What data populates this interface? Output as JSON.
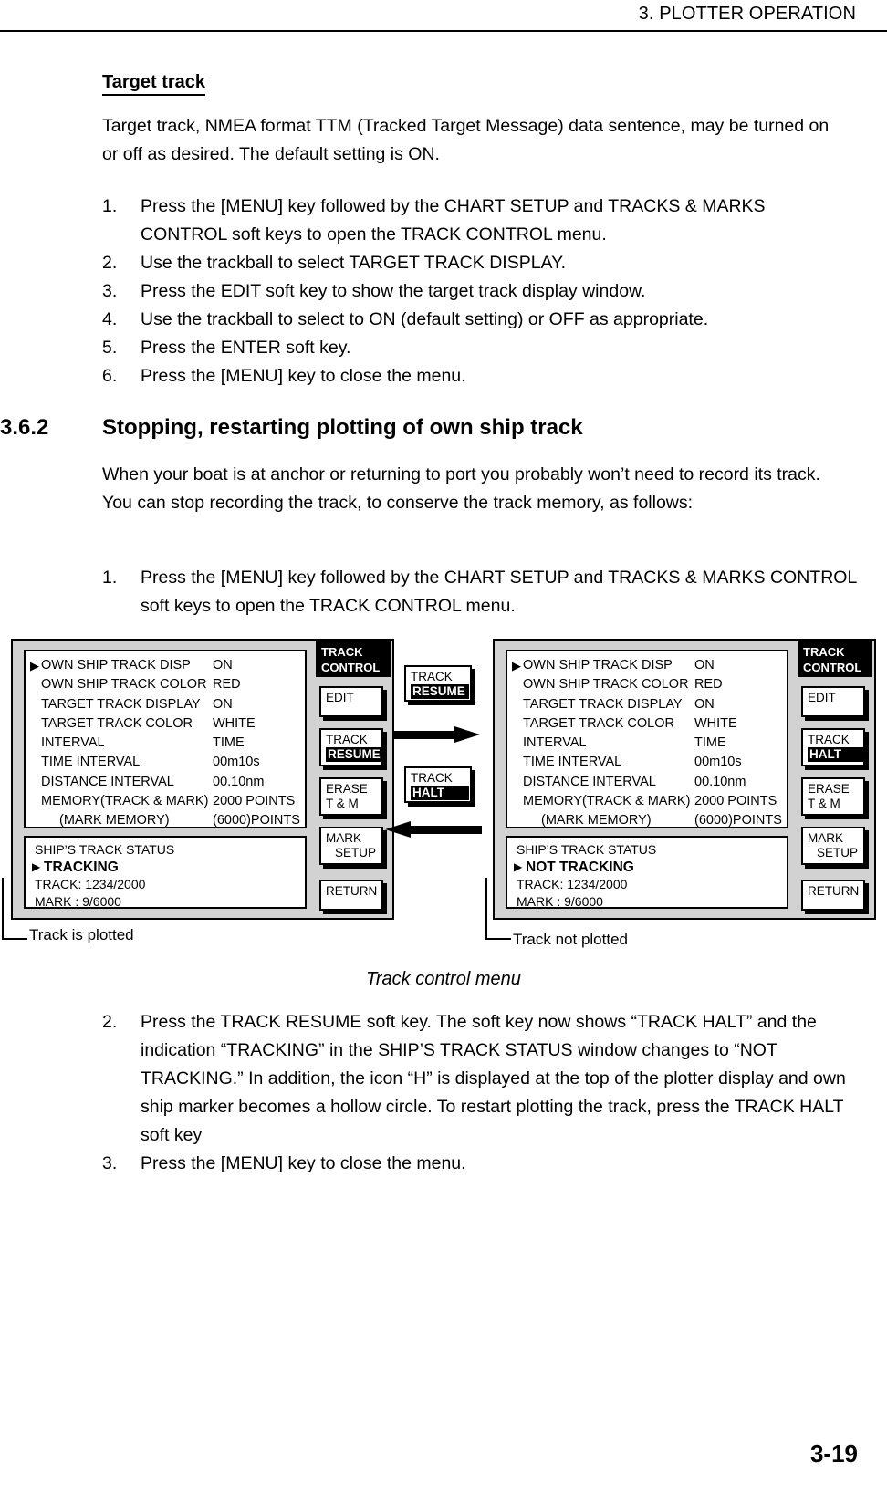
{
  "header": {
    "running_head": "3. PLOTTER OPERATION"
  },
  "footer": {
    "page_number": "3-19"
  },
  "section_target_track": {
    "heading": "Target track",
    "paragraph": "Target track, NMEA format TTM (Tracked Target Message) data sentence, may be turned on or off as desired. The default setting is ON.",
    "steps": [
      {
        "num": "1.",
        "text": "Press the [MENU] key followed by the CHART SETUP and TRACKS & MARKS CONTROL soft keys to open the TRACK CONTROL menu."
      },
      {
        "num": "2.",
        "text": "Use the trackball to select TARGET TRACK DISPLAY."
      },
      {
        "num": "3.",
        "text": "Press the EDIT soft key to show the target track display window."
      },
      {
        "num": "4.",
        "text": "Use the trackball to select to ON (default setting) or OFF as appropriate."
      },
      {
        "num": "5.",
        "text": "Press the ENTER soft key."
      },
      {
        "num": "6.",
        "text": "Press the [MENU] key to close the menu."
      }
    ]
  },
  "section_362": {
    "number": "3.6.2",
    "title": "Stopping, restarting plotting of own ship track",
    "paragraph": "When your boat is at anchor or returning to port you probably won’t need to record its track. You can stop recording the track, to conserve the track memory, as follows:",
    "step1": {
      "num": "1.",
      "text": "Press the [MENU] key followed by the CHART SETUP and TRACKS & MARKS CONTROL soft keys to open the TRACK CONTROL menu."
    },
    "step2": {
      "num": "2.",
      "text": "Press the TRACK RESUME soft key. The soft key now shows “TRACK HALT” and the indication “TRACKING” in the SHIP’S TRACK STATUS window changes to “NOT TRACKING.” In addition, the icon “H” is displayed at the top of the plotter display and own ship marker becomes a hollow circle. To restart plotting the track, press the TRACK HALT soft key"
    },
    "step3": {
      "num": "3.",
      "text": "Press the [MENU] key to close the menu."
    }
  },
  "figure": {
    "title": "Track control menu",
    "caption_left": "Track is plotted",
    "caption_right": "Track not plotted",
    "menu_rows": [
      {
        "cursor": "▶",
        "label": "OWN SHIP TRACK DISP",
        "value": "ON",
        "indent": false
      },
      {
        "cursor": "",
        "label": "OWN SHIP TRACK COLOR",
        "value": "RED",
        "indent": false
      },
      {
        "cursor": "",
        "label": "TARGET TRACK DISPLAY",
        "value": "ON",
        "indent": false
      },
      {
        "cursor": "",
        "label": "TARGET TRACK COLOR",
        "value": "WHITE",
        "indent": false
      },
      {
        "cursor": "",
        "label": "INTERVAL",
        "value": "TIME",
        "indent": false
      },
      {
        "cursor": "",
        "label": "TIME INTERVAL",
        "value": "00m10s",
        "indent": false
      },
      {
        "cursor": "",
        "label": "DISTANCE INTERVAL",
        "value": "00.10nm",
        "indent": false
      },
      {
        "cursor": "",
        "label": "MEMORY(TRACK & MARK)",
        "value": "2000 POINTS",
        "indent": false
      },
      {
        "cursor": "",
        "label": "(MARK MEMORY)",
        "value": "(6000)POINTS",
        "indent": true
      }
    ],
    "left_panel": {
      "status": {
        "title": "SHIP’S TRACK STATUS",
        "cursor": "▶",
        "state": "TRACKING",
        "track": "TRACK: 1234/2000",
        "mark": "MARK :      9/6000"
      },
      "softkeys": {
        "title_line1": "TRACK",
        "title_line2": "CONTROL",
        "key1": "EDIT",
        "key2_line1": "TRACK",
        "key2_line2": "RESUME",
        "key3_line1": "ERASE",
        "key3_line2": "T & M",
        "key4_line1": "MARK",
        "key4_line2": "SETUP",
        "key5": "RETURN"
      }
    },
    "right_panel": {
      "status": {
        "title": "SHIP’S TRACK STATUS",
        "cursor": "▶",
        "state": "NOT TRACKING",
        "track": "TRACK: 1234/2000",
        "mark": "MARK :      9/6000"
      },
      "softkeys": {
        "title_line1": "TRACK",
        "title_line2": "CONTROL",
        "key1": "EDIT",
        "key2_line1": "TRACK",
        "key2_line2": "HALT",
        "key3_line1": "ERASE",
        "key3_line2": "T & M",
        "key4_line1": "MARK",
        "key4_line2": "SETUP",
        "key5": "RETURN"
      }
    },
    "callout_top": {
      "line1": "TRACK",
      "line2": "RESUME"
    },
    "callout_bottom": {
      "line1": "TRACK",
      "line2": "HALT"
    }
  }
}
